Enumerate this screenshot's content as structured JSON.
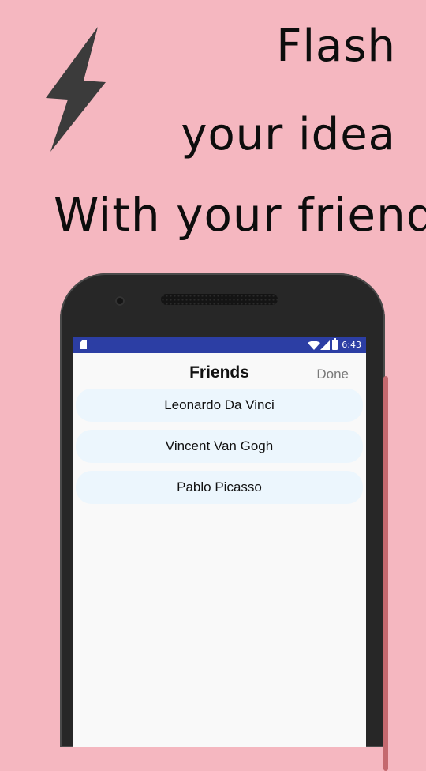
{
  "promo": {
    "line1": "Flash",
    "line2": "your idea",
    "line3": "With your friend",
    "bolt_color": "#3b3b3b",
    "background": "#f5b7c0"
  },
  "status_bar": {
    "time": "6:43",
    "icons": [
      "sd-card-icon",
      "wifi-icon",
      "signal-icon",
      "battery-charging-icon"
    ],
    "color": "#2c3ea4"
  },
  "friends_screen": {
    "title": "Friends",
    "done_label": "Done",
    "friends": [
      {
        "name": "Leonardo Da Vinci"
      },
      {
        "name": "Vincent Van Gogh"
      },
      {
        "name": "Pablo Picasso"
      }
    ],
    "item_color": "#ecf6fd"
  }
}
